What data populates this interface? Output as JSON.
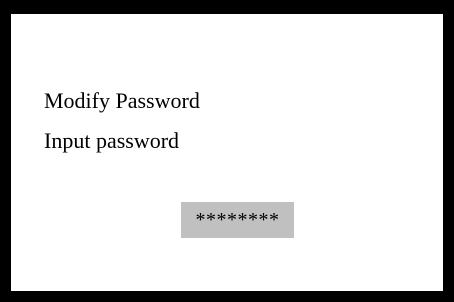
{
  "screen": {
    "title": "Modify Password",
    "prompt": "Input password"
  },
  "password_field": {
    "masked_value": "********"
  },
  "colors": {
    "frame": "#000000",
    "background": "#ffffff",
    "field_background": "#c0c0c0",
    "text": "#000000"
  }
}
